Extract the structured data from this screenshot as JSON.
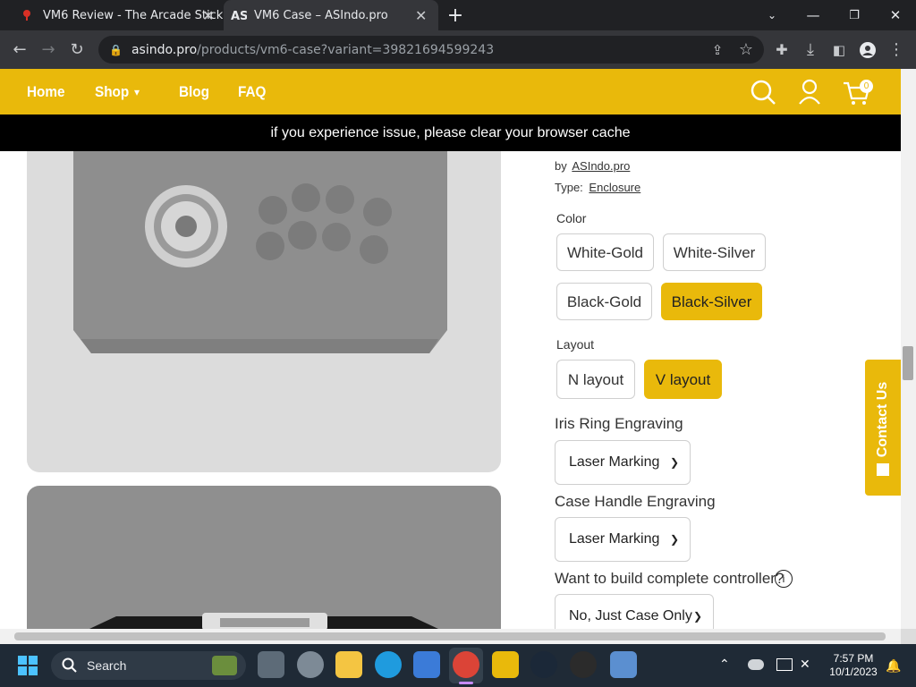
{
  "browser": {
    "tabs": [
      {
        "title": "VM6 Review - The Arcade Stick",
        "favicon": "arcade-stick-favicon"
      },
      {
        "title": "VM6 Case – ASIndo.pro",
        "favicon": "as-logo-favicon"
      }
    ],
    "new_tab": "+",
    "url_host": "asindo.pro",
    "url_path": "/products/vm6-case?variant=39821694599243"
  },
  "site": {
    "nav": [
      "Home",
      "Shop",
      "Blog",
      "FAQ"
    ],
    "cart_count": "0",
    "notice": "if you experience issue, please clear your browser cache"
  },
  "product": {
    "by_prefix": "by",
    "vendor": "ASIndo.pro",
    "type_label": "Type:",
    "type_value": "Enclosure",
    "color_label": "Color",
    "colors": [
      "White-Gold",
      "White-Silver",
      "Black-Gold",
      "Black-Silver"
    ],
    "selected_color": "Black-Silver",
    "layout_label": "Layout",
    "layouts": [
      "N layout",
      "V layout"
    ],
    "selected_layout": "V layout",
    "iris_label": "Iris Ring Engraving",
    "iris_value": "Laser Marking",
    "handle_label": "Case Handle Engraving",
    "handle_value": "Laser Marking",
    "build_label": "Want to build complete controller?",
    "build_value": "No, Just Case Only",
    "contact_label": "Contact Us"
  },
  "taskbar": {
    "search_label": "Search",
    "time": "7:57 PM",
    "date": "10/1/2023"
  },
  "colors": {
    "brand": "#e9b90b",
    "dark": "#202124"
  }
}
